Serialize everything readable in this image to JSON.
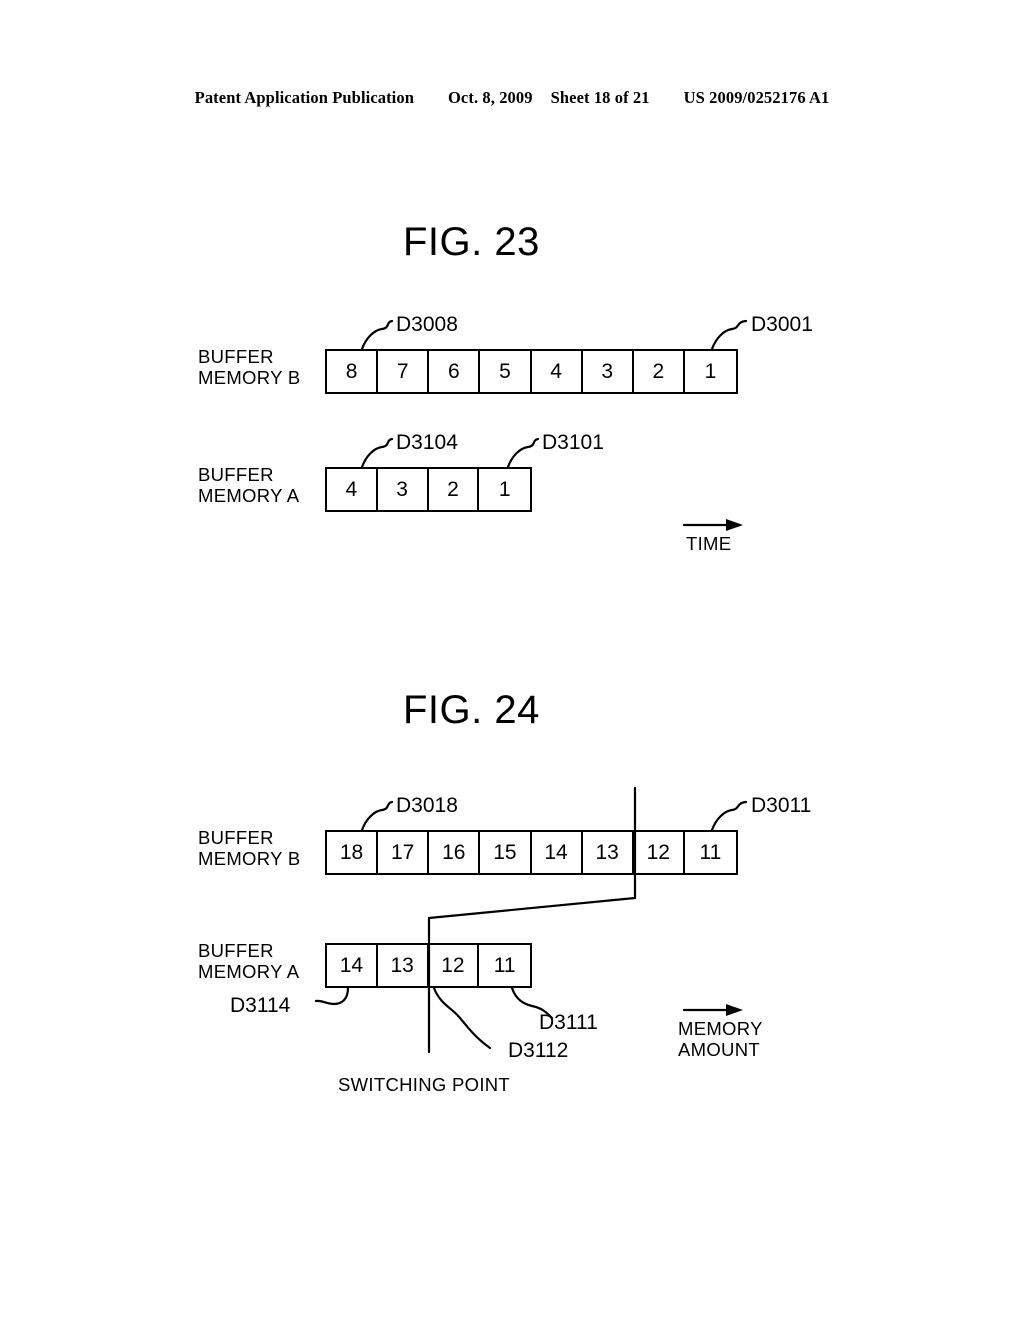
{
  "header": {
    "publication": "Patent Application Publication",
    "date": "Oct. 8, 2009",
    "sheet": "Sheet 18 of 21",
    "patent_number": "US 2009/0252176 A1"
  },
  "figures": [
    {
      "title": "FIG. 23",
      "rows": [
        {
          "label_line1": "BUFFER",
          "label_line2": "MEMORY B",
          "cells": [
            "8",
            "7",
            "6",
            "5",
            "4",
            "3",
            "2",
            "1"
          ],
          "ref_left": "D3008",
          "ref_right": "D3001"
        },
        {
          "label_line1": "BUFFER",
          "label_line2": "MEMORY A",
          "cells": [
            "4",
            "3",
            "2",
            "1"
          ],
          "ref_left": "D3104",
          "ref_right": "D3101"
        }
      ],
      "axis_caption": "TIME"
    },
    {
      "title": "FIG. 24",
      "rows": [
        {
          "label_line1": "BUFFER",
          "label_line2": "MEMORY B",
          "cells": [
            "18",
            "17",
            "16",
            "15",
            "14",
            "13",
            "12",
            "11"
          ],
          "ref_left": "D3018",
          "ref_right": "D3011"
        },
        {
          "label_line1": "BUFFER",
          "label_line2": "MEMORY A",
          "cells": [
            "14",
            "13",
            "12",
            "11"
          ],
          "ref_left": "D3114",
          "ref_mid": "D3112",
          "ref_right": "D3111"
        }
      ],
      "switching_point_caption": "SWITCHING POINT",
      "axis_caption_line1": "MEMORY",
      "axis_caption_line2": "AMOUNT"
    }
  ],
  "colors": {
    "ink": "#000000",
    "paper": "#ffffff"
  }
}
